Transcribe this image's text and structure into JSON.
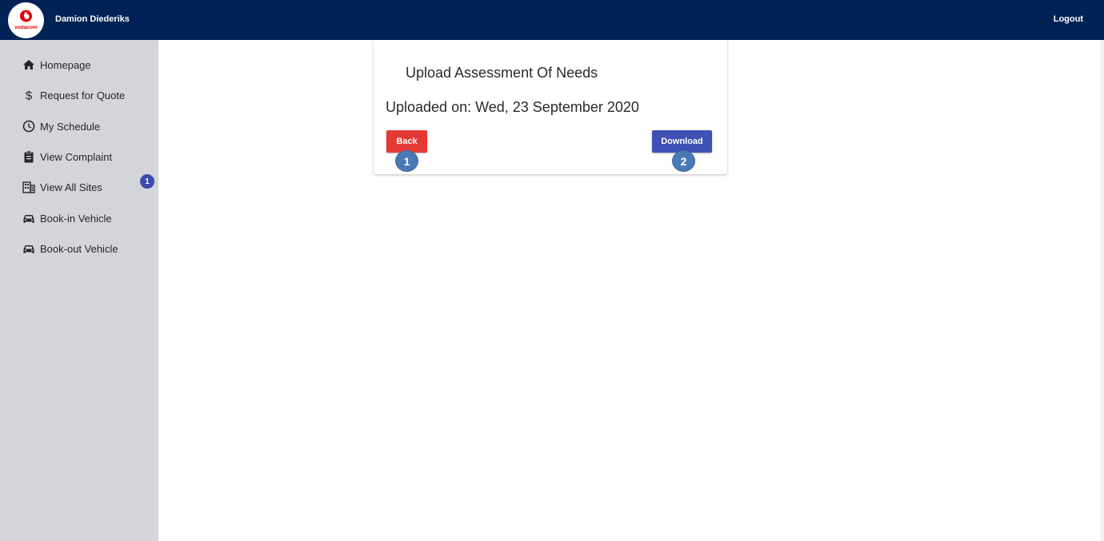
{
  "header": {
    "logo_text": "vodacom",
    "user_name": "Damion Diederiks",
    "logout_label": "Logout",
    "bg_color": "#002255"
  },
  "sidebar": {
    "items": [
      {
        "label": "Homepage",
        "icon": "home-icon"
      },
      {
        "label": "Request for Quote",
        "icon": "dollar-icon"
      },
      {
        "label": "My Schedule",
        "icon": "clock-icon"
      },
      {
        "label": "View Complaint",
        "icon": "clipboard-icon"
      },
      {
        "label": "View All Sites",
        "icon": "building-icon"
      },
      {
        "label": "Book-in Vehicle",
        "icon": "car-icon"
      },
      {
        "label": "Book-out Vehicle",
        "icon": "car-icon"
      }
    ],
    "badge_count": "1"
  },
  "card": {
    "title": "Upload Assessment Of Needs",
    "uploaded_text": "Uploaded on: Wed, 23 September 2020",
    "back_label": "Back",
    "download_label": "Download",
    "marker_1": "1",
    "marker_2": "2"
  },
  "colors": {
    "back_button": "#e53935",
    "download_button": "#3f51b5",
    "badge": "#3c4aae",
    "marker": "#4a7ab5",
    "sidebar_bg": "#d4d5d9"
  }
}
